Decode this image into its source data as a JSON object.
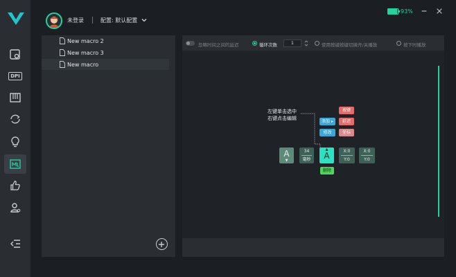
{
  "header": {
    "user_status": "未登录",
    "config_label": "配置: 默认配置"
  },
  "battery": {
    "percent_label": "93%",
    "level": 0.93
  },
  "rail": {
    "items": [
      "home",
      "dpi",
      "keys",
      "sync",
      "light",
      "macro",
      "like",
      "user"
    ],
    "active": "macro",
    "dpi_label": "DPI"
  },
  "macros": [
    {
      "name": "New macro 2"
    },
    {
      "name": "New macro 3"
    },
    {
      "name": "New macro"
    }
  ],
  "selected_macro_index": 2,
  "toolbar": {
    "ignore_delay": "忽略时间之间的延迟",
    "loop_count_label": "循环次数",
    "loop_count_value": "1",
    "toggle_play": "使用按键按键切换开/关播放",
    "hold_play": "按下时播放"
  },
  "canvas": {
    "tip_line1": "左键单击选中",
    "tip_line2": "右键点击编辑",
    "key_a": "A",
    "key_a_arrow": "▼",
    "delay_value": "34",
    "delay_unit": "毫秒",
    "key_selected": "A",
    "key_selected_arrow": "▲",
    "xy1_x": "X:0",
    "xy1_y": "Y:0",
    "xy2_x": "X:0",
    "xy2_y": "Y:0",
    "menu_add": "添加 ▸",
    "menu_edit": "修改",
    "menu_key": "按键",
    "menu_delay": "延迟",
    "menu_coord": "坐标",
    "menu_delete": "删除"
  },
  "colors": {
    "accent": "#22d3a0",
    "rail_bg": "#2a2e33",
    "selected_key": "#27e3c2"
  }
}
